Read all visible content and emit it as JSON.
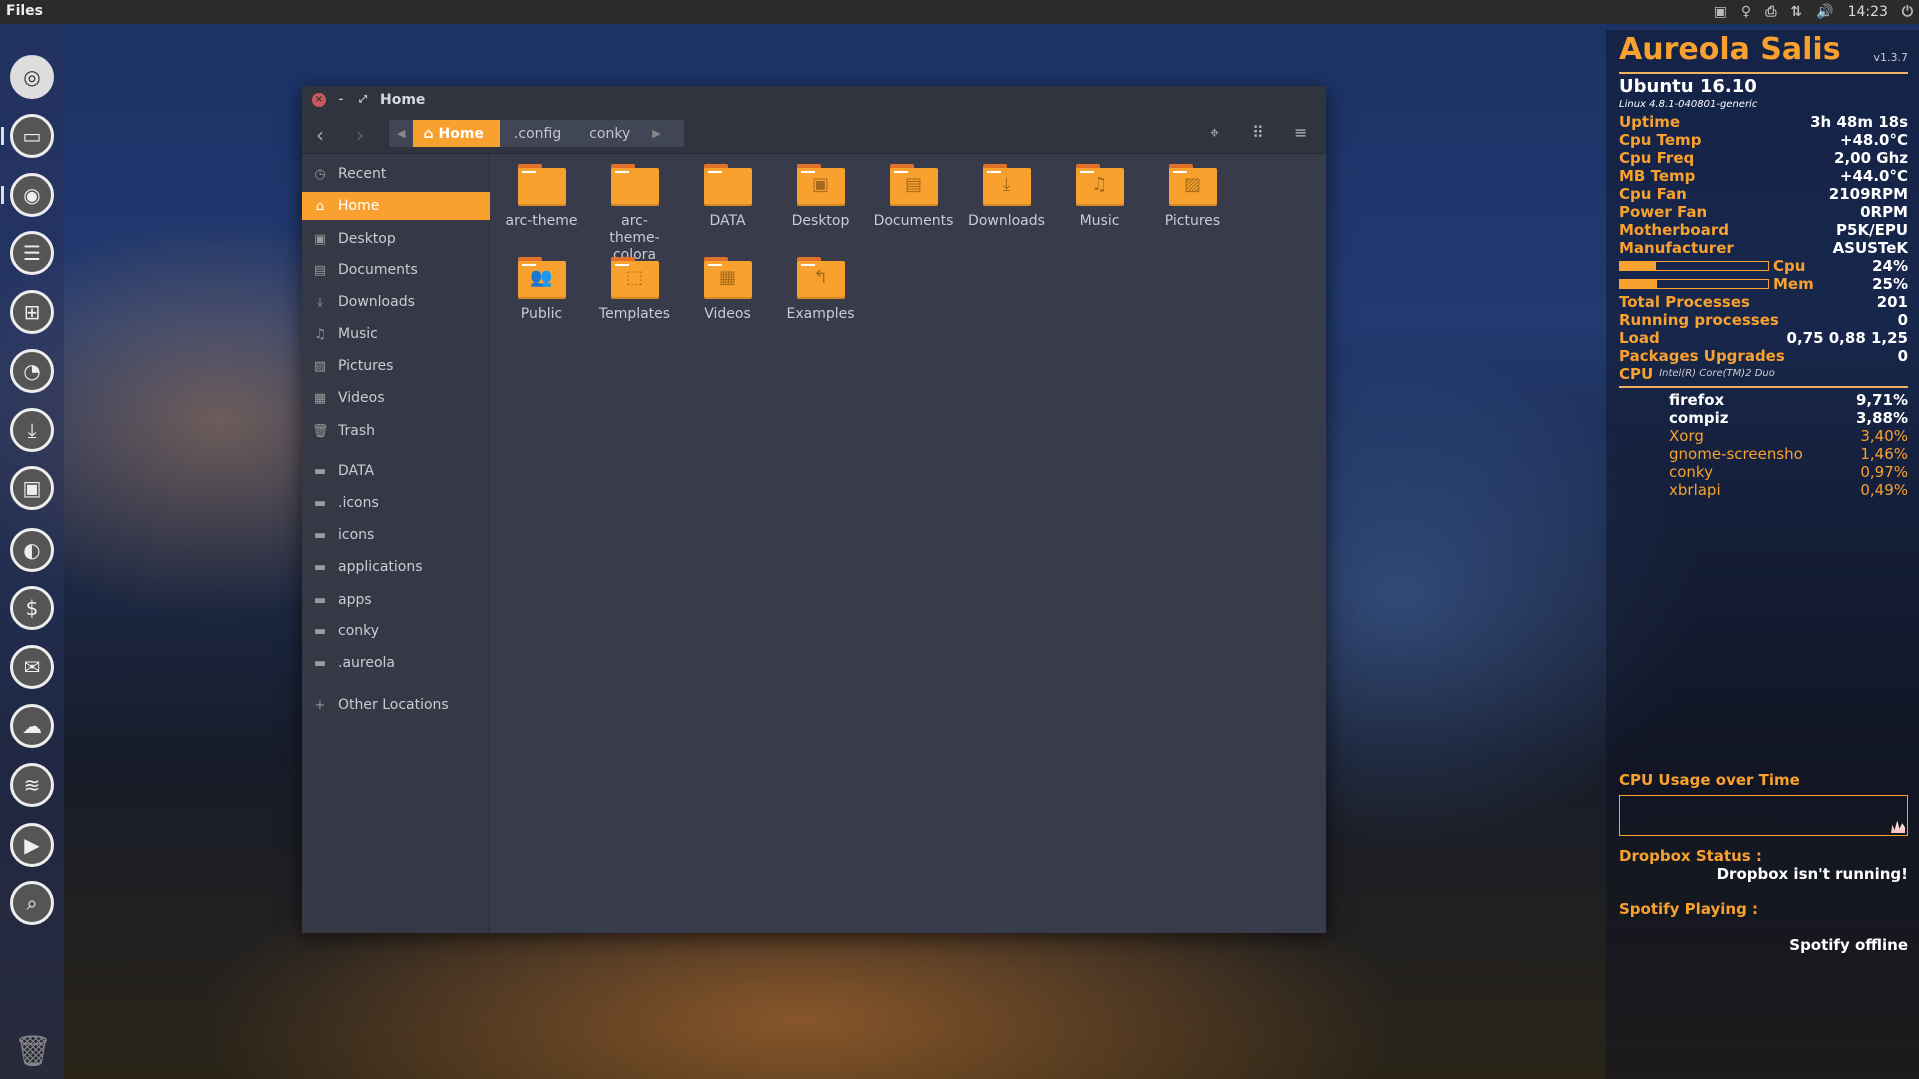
{
  "topbar": {
    "app_name": "Files",
    "clock": "14:23",
    "tray_icons": [
      "screenshot-icon",
      "bulb-icon",
      "printer-icon",
      "network-icon",
      "volume-icon",
      "session-icon"
    ]
  },
  "launcher": {
    "items": [
      "ubuntu-dash",
      "files",
      "firefox",
      "text-editor",
      "spreadsheet",
      "presentation",
      "downloads",
      "screenshot",
      "toggle-settings",
      "finance",
      "thunderbird",
      "software-center",
      "spotify",
      "video-camera",
      "search-app",
      "trash"
    ]
  },
  "window": {
    "title": "Home",
    "breadcrumb": [
      "Home",
      ".config",
      "conky"
    ],
    "sidebar": [
      {
        "label": "Recent",
        "icon": "clock-icon",
        "glyph": "◷"
      },
      {
        "label": "Home",
        "icon": "home-icon",
        "glyph": "⌂",
        "active": true
      },
      {
        "label": "Desktop",
        "icon": "desktop-icon",
        "glyph": "▣"
      },
      {
        "label": "Documents",
        "icon": "document-icon",
        "glyph": "▤"
      },
      {
        "label": "Downloads",
        "icon": "download-icon",
        "glyph": "⤓"
      },
      {
        "label": "Music",
        "icon": "music-icon",
        "glyph": "♫"
      },
      {
        "label": "Pictures",
        "icon": "picture-icon",
        "glyph": "▨"
      },
      {
        "label": "Videos",
        "icon": "film-icon",
        "glyph": "▦"
      },
      {
        "label": "Trash",
        "icon": "trash-icon",
        "glyph": "🗑"
      },
      {
        "label": "DATA",
        "icon": "folder-icon",
        "glyph": "▬"
      },
      {
        "label": ".icons",
        "icon": "folder-icon",
        "glyph": "▬"
      },
      {
        "label": "icons",
        "icon": "folder-icon",
        "glyph": "▬"
      },
      {
        "label": "applications",
        "icon": "folder-icon",
        "glyph": "▬"
      },
      {
        "label": "apps",
        "icon": "folder-icon",
        "glyph": "▬"
      },
      {
        "label": "conky",
        "icon": "folder-icon",
        "glyph": "▬"
      },
      {
        "label": ".aureola",
        "icon": "folder-icon",
        "glyph": "▬"
      },
      {
        "label": "Other Locations",
        "icon": "plus-icon",
        "glyph": "+"
      }
    ],
    "files": [
      {
        "name": "arc-theme",
        "glyph": ""
      },
      {
        "name": "arc-theme-colora",
        "glyph": ""
      },
      {
        "name": "DATA",
        "glyph": ""
      },
      {
        "name": "Desktop",
        "glyph": "▣"
      },
      {
        "name": "Documents",
        "glyph": "▤"
      },
      {
        "name": "Downloads",
        "glyph": "⤓"
      },
      {
        "name": "Music",
        "glyph": "♫"
      },
      {
        "name": "Pictures",
        "glyph": "▨"
      },
      {
        "name": "Public",
        "glyph": "👥"
      },
      {
        "name": "Templates",
        "glyph": "⬚"
      },
      {
        "name": "Videos",
        "glyph": "▦"
      },
      {
        "name": "Examples",
        "glyph": "↰"
      }
    ]
  },
  "conky": {
    "title": "Aureola Salis",
    "version": "v1.3.7",
    "os": "Ubuntu 16.10",
    "kernel": "Linux 4.8.1-040801-generic",
    "stats": [
      [
        "Uptime",
        "3h 48m 18s"
      ],
      [
        "Cpu Temp",
        "+48.0°C"
      ],
      [
        "Cpu Freq",
        "2,00 Ghz"
      ],
      [
        "MB Temp",
        "+44.0°C"
      ],
      [
        "Cpu Fan",
        "2109RPM"
      ],
      [
        "Power Fan",
        "0RPM"
      ],
      [
        "Motherboard",
        "P5K/EPU"
      ],
      [
        "Manufacturer",
        "ASUSTeK"
      ]
    ],
    "bars": [
      {
        "label": "Cpu",
        "value": "24%",
        "fraction": 0.24
      },
      {
        "label": "Mem",
        "value": "25%",
        "fraction": 0.25
      }
    ],
    "stats2": [
      [
        "Total Processes",
        "201"
      ],
      [
        "Running processes",
        "0"
      ],
      [
        "Load",
        "0,75 0,88 1,25"
      ],
      [
        "Packages Upgrades",
        "0"
      ]
    ],
    "cpu_label": "CPU",
    "cpu_model": "Intel(R) Core(TM)2 Duo",
    "processes": [
      [
        "firefox",
        "9,71%"
      ],
      [
        "compiz",
        "3,88%"
      ],
      [
        "Xorg",
        "3,40%"
      ],
      [
        "gnome-screensho",
        "1,46%"
      ],
      [
        "conky",
        "0,97%"
      ],
      [
        "xbrlapi",
        "0,49%"
      ]
    ],
    "graph_title": "CPU Usage over Time",
    "dropbox_label": "Dropbox Status :",
    "dropbox_value": "Dropbox isn't running!",
    "spotify_label": "Spotify Playing :",
    "spotify_value": "Spotify offline",
    "accent": "#f9a12e"
  }
}
